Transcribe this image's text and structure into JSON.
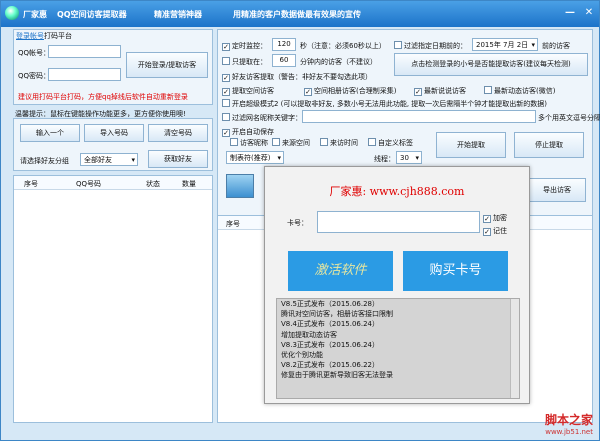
{
  "titlebar": {
    "brand": "厂家惠",
    "app_name": "QQ空间访客提取器",
    "tool": "精准营销神器",
    "slogan": "用精准的客户数据做最有效果的宣传",
    "minimize": "—",
    "close": "✕"
  },
  "login": {
    "tabs": [
      "登录帐号",
      "打码平台"
    ],
    "qq_label": "QQ帐号：",
    "pwd_label": "QQ密码：",
    "login_button": "开始登录/提取访客",
    "tip": "建议用打码平台打码，方便qq掉线后软件自动重新登录"
  },
  "reminder": "温馨提示：鼠标在键能操作功能更多，更方便你使用噢!",
  "friend_buttons": {
    "import_one": "输入一个",
    "import_numbers": "导入号码",
    "clear_numbers": "清空号码",
    "group_label": "请选择好友分组",
    "group_value": "全部好友",
    "get_friends": "获取好友"
  },
  "left_table": {
    "columns": [
      "序号",
      "QQ号码",
      "状态",
      "数量"
    ]
  },
  "options": {
    "timer_label": "定时监控：",
    "timer_value": "120",
    "timer_note": "秒（注意：必须60秒以上）",
    "filter_date_label": "过滤指定日期前的：",
    "date_value": "2015年 7月 2日",
    "date_suffix": "前的访客",
    "limit_label": "只提取在：",
    "limit_value": "60",
    "limit_note": "分钟内的访客（不建议）",
    "detect_button": "点击检测登录的小号是否能提取访客(建议每天检测)",
    "friend_visitor": "好友访客提取（警告：非好友不要勾选此项）",
    "row4": [
      "提取空间访客",
      "空间相册访客(合理制采集)",
      "最新说说访客",
      "最新动态访客(微信)"
    ],
    "super_mode": "开启超级模式2 (可以提取非好友, 多数小号无法用此功能, 提取一次后需隔半个钟才能提取出新的数据)",
    "keyword_label": "过滤网名昵称关键字：",
    "keyword_hint": "多个用英文逗号分隔",
    "auto_save": "开启自动保存",
    "save_fields": [
      "访客昵称",
      "来源空间",
      "来访时间",
      "自定义标签"
    ],
    "format_value": "制表符(推荐)",
    "threads_label": "线程：",
    "threads_value": "30",
    "start_button": "开始提取",
    "stop_button": "停止提取",
    "export_button": "导出访客"
  },
  "right_table": {
    "columns": [
      "序号"
    ]
  },
  "popup": {
    "headline": "厂家惠: www.cjh888.com",
    "card_label": "卡号：",
    "encrypt": "加密",
    "remember": "记住",
    "activate_button": "激活软件",
    "buy_button": "购买卡号",
    "notes": [
      "V8.5正式发布（2015.06.28）",
      "腾讯对空间访客，相册访客接口限制",
      "",
      "V8.4正式发布（2015.06.24）",
      "增加提取动态访客",
      "",
      "V8.3正式发布（2015.06.24）",
      "优化个别功能",
      "",
      "V8.2正式发布（2015.06.22）",
      "修复由于腾讯更新导致旧客无法登录"
    ]
  },
  "watermark": {
    "main": "脚本之家",
    "sub": "www.jb51.net"
  },
  "colors": {
    "title_bar": "#1c73c9",
    "accent_button": "#2b9be4",
    "tip_red": "#e00000"
  }
}
